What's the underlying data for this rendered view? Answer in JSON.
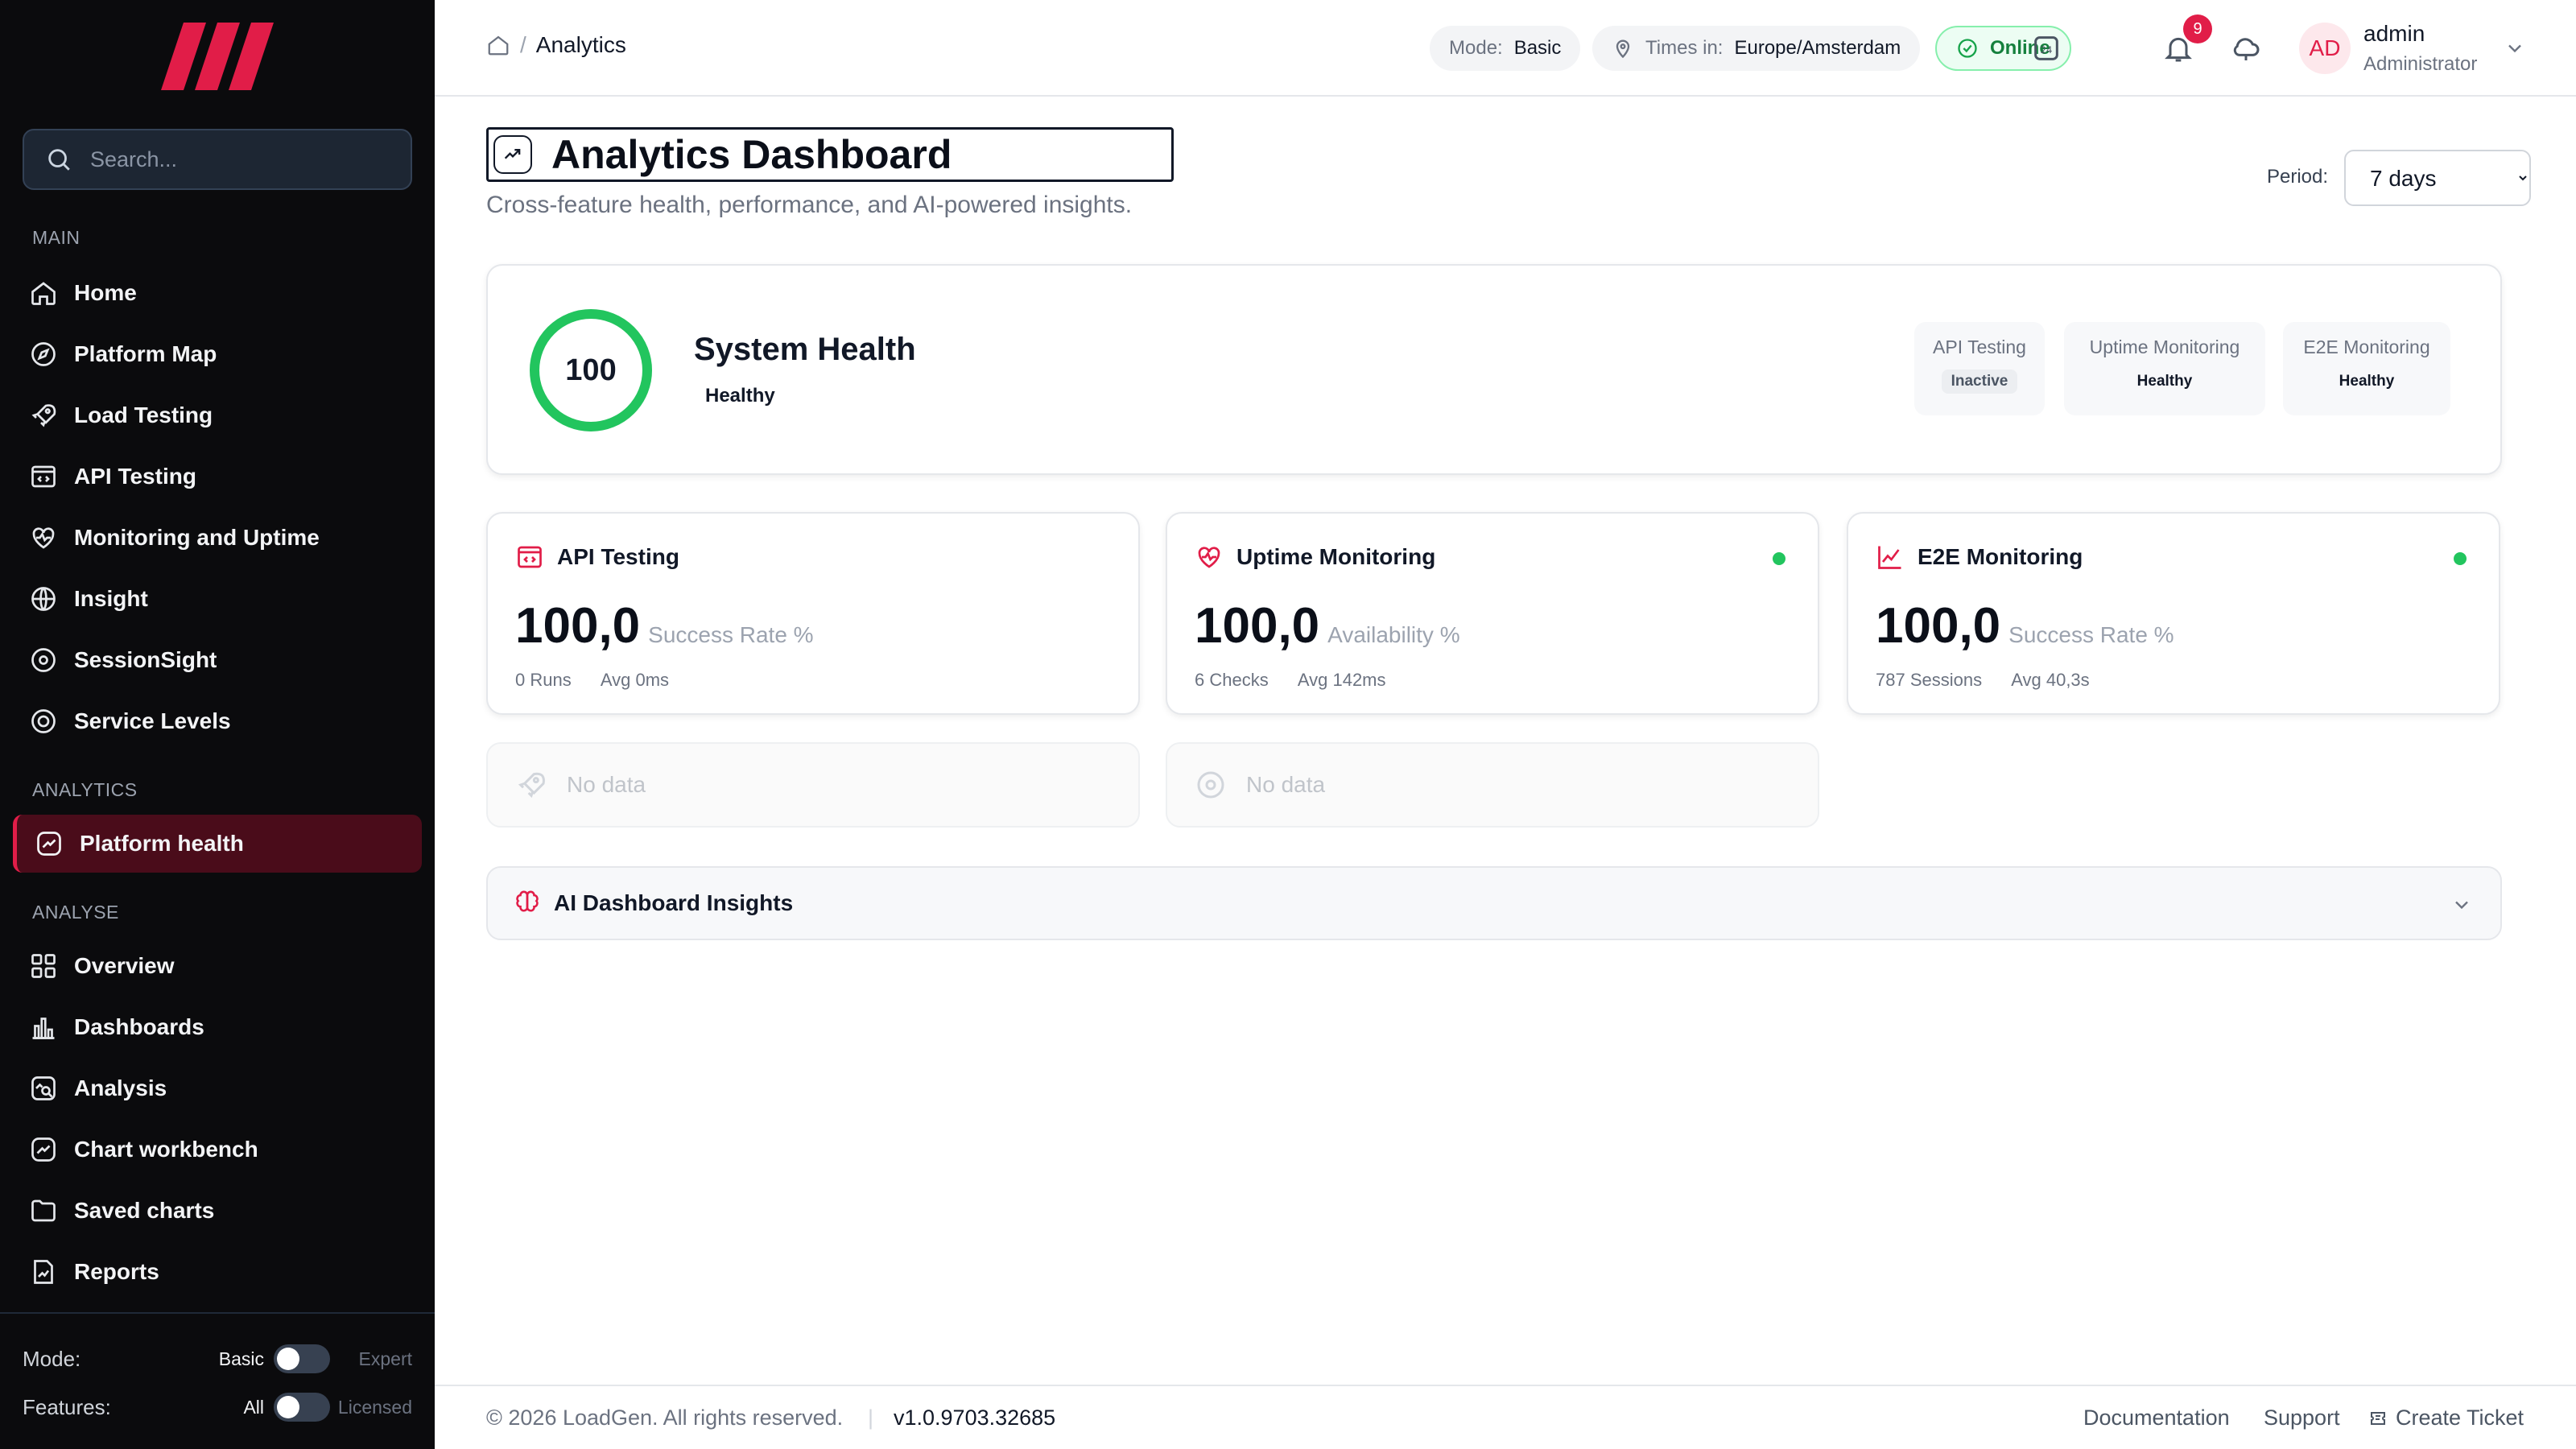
{
  "sidebar": {
    "search_placeholder": "Search...",
    "sections": {
      "main": "MAIN",
      "analytics": "ANALYTICS",
      "analyse": "ANALYSE"
    },
    "main_items": [
      "Home",
      "Platform Map",
      "Load Testing",
      "API Testing",
      "Monitoring and Uptime",
      "Insight",
      "SessionSight",
      "Service Levels"
    ],
    "analytics_items": [
      "Platform health"
    ],
    "analyse_items": [
      "Overview",
      "Dashboards",
      "Analysis",
      "Chart workbench",
      "Saved charts",
      "Reports"
    ],
    "mode": {
      "label": "Mode:",
      "value": "Basic",
      "alt": "Expert"
    },
    "features": {
      "label": "Features:",
      "value": "All",
      "alt": "Licensed"
    }
  },
  "header": {
    "breadcrumb_sep": "/",
    "breadcrumb_current": "Analytics",
    "mode_label": "Mode:",
    "mode_value": "Basic",
    "tz_label": "Times in:",
    "tz_value": "Europe/Amsterdam",
    "status": "Online",
    "notification_count": "9",
    "user": {
      "initials": "AD",
      "name": "admin",
      "role": "Administrator"
    }
  },
  "page": {
    "title": "Analytics Dashboard",
    "subtitle": "Cross-feature health, performance, and AI-powered insights.",
    "period_label": "Period:",
    "period_value": "7 days"
  },
  "health": {
    "score": "100",
    "score_fraction": 1.0,
    "title": "System Health",
    "status": "Healthy",
    "features": [
      {
        "name": "API Testing",
        "status": "Inactive"
      },
      {
        "name": "Uptime Monitoring",
        "status": "Healthy"
      },
      {
        "name": "E2E Monitoring",
        "status": "Healthy"
      }
    ]
  },
  "metrics": [
    {
      "title": "API Testing",
      "value": "100,0",
      "unit": "Success Rate %",
      "stat1": "0 Runs",
      "stat2": "Avg 0ms"
    },
    {
      "title": "Uptime Monitoring",
      "value": "100,0",
      "unit": "Availability %",
      "stat1": "6 Checks",
      "stat2": "Avg 142ms"
    },
    {
      "title": "E2E Monitoring",
      "value": "100,0",
      "unit": "Success Rate %",
      "stat1": "787 Sessions",
      "stat2": "Avg 40,3s"
    }
  ],
  "no_data": [
    "No data",
    "No data"
  ],
  "insights": {
    "title": "AI Dashboard Insights"
  },
  "footer": {
    "copyright": "© 2026 LoadGen. All rights reserved.",
    "sep": "|",
    "version": "v1.0.9703.32685",
    "links": [
      "Documentation",
      "Support",
      "Create Ticket"
    ]
  },
  "colors": {
    "accent": "#e11d48",
    "healthy": "#22c55e",
    "sidebar_bg": "#0b0b0d",
    "active_bg": "#4a0c1a"
  },
  "icons": {
    "main": [
      "home-icon",
      "compass-icon",
      "rocket-icon",
      "code-window-icon",
      "heart-pulse-icon",
      "globe-icon",
      "eye-icon",
      "settings-icon"
    ],
    "analytics": [
      "trend-chart-icon"
    ],
    "analyse": [
      "grid-icon",
      "bar-chart-icon",
      "chart-magnifier-icon",
      "chart-square-icon",
      "folder-icon",
      "report-icon"
    ]
  }
}
